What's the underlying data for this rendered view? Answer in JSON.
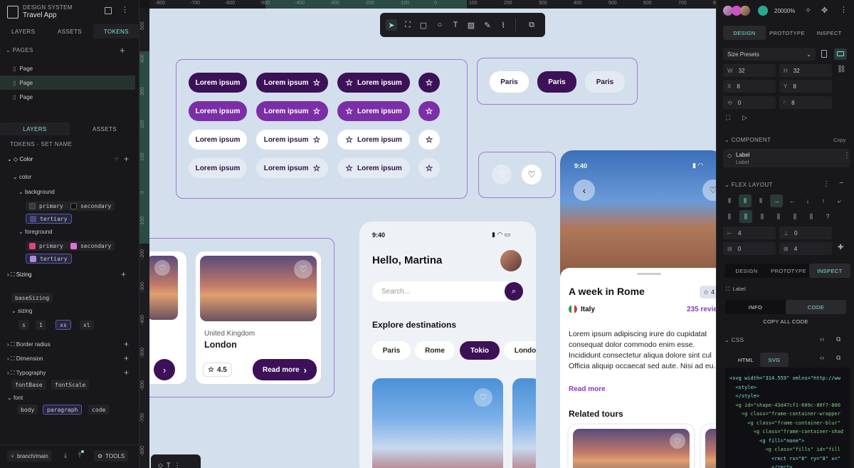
{
  "app": {
    "section": "DESIGN SYSTEM",
    "title": "Travel App"
  },
  "left_tabs": [
    "LAYERS",
    "ASSETS",
    "TOKENS"
  ],
  "pages": {
    "header": "PAGES",
    "items": [
      "Page",
      "Page",
      "Page"
    ]
  },
  "sub_tabs": [
    "LAYERS",
    "ASSETS"
  ],
  "tokens": {
    "header": "TOKENS - SET NAME",
    "color_group": "Color",
    "color_label": "color",
    "background_label": "background",
    "background": [
      "primary",
      "secondary",
      "tertiary"
    ],
    "foreground_label": "foreground",
    "foreground": [
      "primary",
      "secondary",
      "tertiary"
    ],
    "sizing_group": "Sizing",
    "base_sizing": "baseSizing",
    "sizing_label": "sizing",
    "sizing_values": [
      "s",
      "1",
      "xs",
      "xl"
    ],
    "border_radius": "Border radius",
    "dimension": "Dimension",
    "typography": "Typography",
    "font_tokens": [
      "fontBase",
      "fontScale"
    ],
    "font_label": "font",
    "font_values": [
      "body",
      "paragraph",
      "code"
    ]
  },
  "branch": "branch/main",
  "tools_label": "TOOLS",
  "ruler_top": [
    "-800",
    "-700",
    "-600",
    "-500",
    "-400",
    "-300",
    "-200",
    "-100",
    "0",
    "100",
    "200",
    "300",
    "400",
    "500",
    "600",
    "700",
    "800"
  ],
  "ruler_left": [
    "500",
    "400",
    "300",
    "200",
    "100",
    "0",
    "-100",
    "-200",
    "-300",
    "-400",
    "-500",
    "-600",
    "-700",
    "-800"
  ],
  "canvas": {
    "button_text": "Lorem ipsum",
    "city_chips": [
      "Paris",
      "Paris",
      "Paris"
    ],
    "card1": {
      "country": "United Kingdom",
      "city": "London",
      "rating": "4.5",
      "cta": "Read more"
    },
    "phone1": {
      "time": "9:40",
      "greeting": "Hello, Martina",
      "search_placeholder": "Search...",
      "explore": "Explore destinations",
      "chips": [
        "Paris",
        "Rome",
        "Tokio",
        "Londo"
      ]
    },
    "phone2": {
      "time": "9:40",
      "title": "A week in Rome",
      "country": "Italy",
      "reviews": "235 revie",
      "body": "Lorem ipsum adipiscing irure do cupidatat consequat dolor commodo enim esse. Incididunt consectetur aliqua dolore sint cul Officia aliquip occaecat sed aute. Nisi ad eu.",
      "read_more": "Read more",
      "related": "Related tours",
      "rating": "4"
    }
  },
  "right": {
    "zoom": "20000%",
    "tabs": [
      "DESIGN",
      "PROTOTYPE",
      "INSPECT"
    ],
    "size_presets": "Size Presets",
    "fields": {
      "W": "32",
      "H": "32",
      "X": "8",
      "Y": "8",
      "rot": "0",
      "rad": "8"
    },
    "component_header": "COMPONENT",
    "component_action": "Copy",
    "component_name": "Label",
    "component_sub": "Label",
    "flex_header": "FLEX LAYOUT",
    "flex_fields": [
      "4",
      "0",
      "0",
      "4"
    ],
    "tabs2": [
      "DESIGN",
      "PROTOTYPE",
      "INSPECT"
    ],
    "breadcrumb": "Label",
    "info_tabs": [
      "INFO",
      "CODE"
    ],
    "copy_all": "COPY ALL CODE",
    "css_label": "CSS",
    "code_tabs": [
      "HTML",
      "SVG"
    ],
    "code_lines": [
      "<svg width=\"314.559\" xmlns=\"http://ww",
      "  <style>",
      "  </style>",
      "  <g id=\"shape-43d47cf1-609c-80f7-800",
      "    <g class=\"frame-container-wrapper",
      "      <g class=\"frame-container-blur\"",
      "        <g class=\"frame-container-shad",
      "          <g fill=\"none\">",
      "            <g class=\"fills\" id=\"fill",
      "              <rect rx=\"8\" ry=\"8\" x=\"",
      "              </rect>",
      "            </g>",
      "          <g class=\"frame-children\""
    ]
  }
}
